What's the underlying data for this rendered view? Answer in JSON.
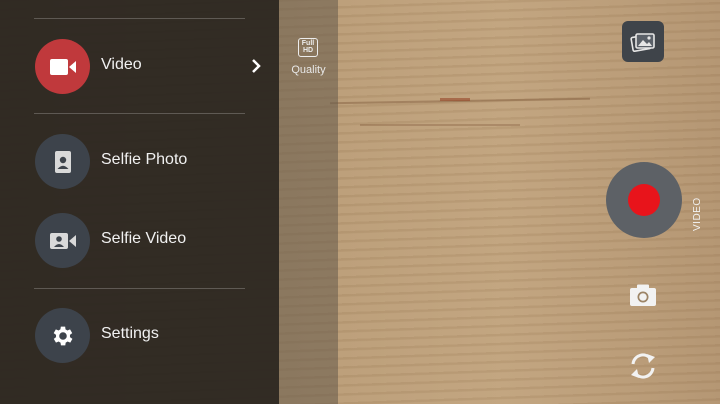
{
  "menu": {
    "items": [
      {
        "label": "Video",
        "icon": "video-camera-icon",
        "active": true
      },
      {
        "label": "Selfie Photo",
        "icon": "portrait-icon",
        "active": false
      },
      {
        "label": "Selfie Video",
        "icon": "selfie-video-icon",
        "active": false
      },
      {
        "label": "Settings",
        "icon": "gear-icon",
        "active": false
      }
    ]
  },
  "quality": {
    "badge_line1": "Full",
    "badge_line2": "HD",
    "label": "Quality"
  },
  "controls": {
    "mode_label": "VIDEO",
    "gallery_icon": "gallery-icon",
    "shutter_icon": "record-icon",
    "photo_icon": "camera-icon",
    "switch_icon": "switch-camera-icon"
  },
  "colors": {
    "active_mode": "#c0393c",
    "record": "#e8141b",
    "menu_bg": "#28241e"
  }
}
